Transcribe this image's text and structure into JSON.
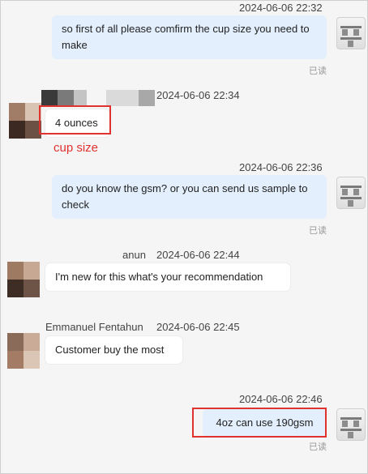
{
  "messages": [
    {
      "time": "2024-06-06 22:32",
      "text": "so first of all please comfirm the cup size you need to make",
      "read": "已读"
    },
    {
      "time": "2024-06-06 22:34",
      "text": "4 ounces"
    },
    {
      "time": "2024-06-06 22:36",
      "text": "do you know the gsm? or you can send us sample to check",
      "read": "已读"
    },
    {
      "name": "anun",
      "time": "2024-06-06 22:44",
      "text": "I'm new for this what's your recommendation"
    },
    {
      "name": "Emmanuel Fentahun",
      "time": "2024-06-06 22:45",
      "text": "Customer buy the most"
    },
    {
      "time": "2024-06-06 22:46",
      "text": "4oz can use 190gsm",
      "read": "已读"
    }
  ],
  "annotation": {
    "label": "cup size",
    "color": "#e0322f"
  },
  "colors": {
    "outgoing_bubble": "#e3effd",
    "incoming_bubble": "#ffffff",
    "highlight": "#e0322f"
  },
  "icons": [
    "seller-avatar",
    "buyer-avatar"
  ]
}
